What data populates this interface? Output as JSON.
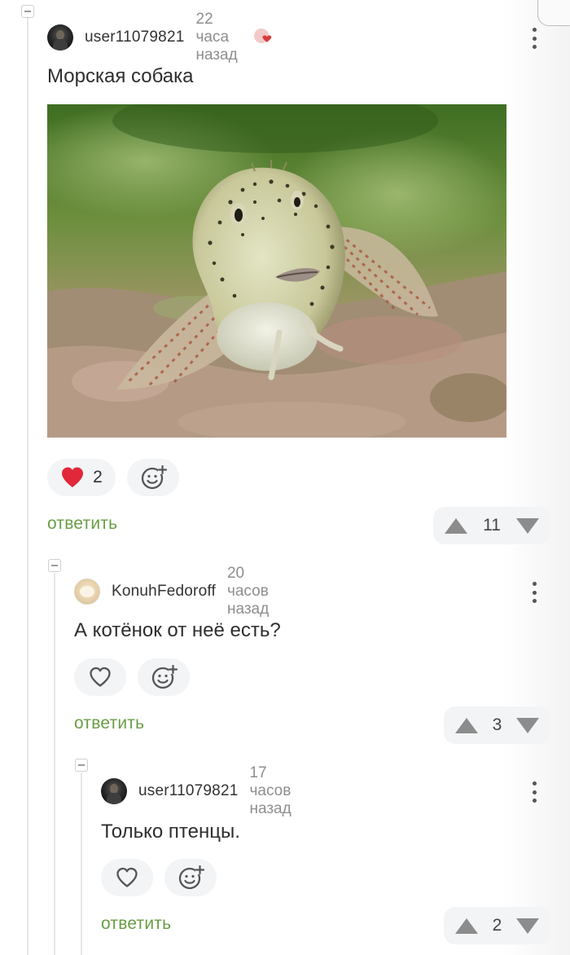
{
  "post": {
    "username": "user11079821",
    "time": "22 часа назад",
    "text": "Морская собака",
    "image_alt": "fish-photo",
    "likes": "2",
    "reply_label": "ответить",
    "score": "11"
  },
  "replies": [
    {
      "username": "KonuhFedoroff",
      "time": "20 часов назад",
      "text": "А котёнок от неё есть?",
      "reply_label": "ответить",
      "score": "3"
    },
    {
      "username": "user11079821",
      "time": "17 часов назад",
      "text": "Только птенцы.",
      "reply_label": "ответить",
      "score": "2"
    }
  ],
  "colors": {
    "accent_green": "#6a9d45",
    "like_red": "#e0283a",
    "pill_bg": "#f3f4f6"
  },
  "icons": [
    "collapse-icon",
    "heart-icon",
    "add-reaction-icon",
    "upvote-icon",
    "downvote-icon",
    "more-icon"
  ]
}
